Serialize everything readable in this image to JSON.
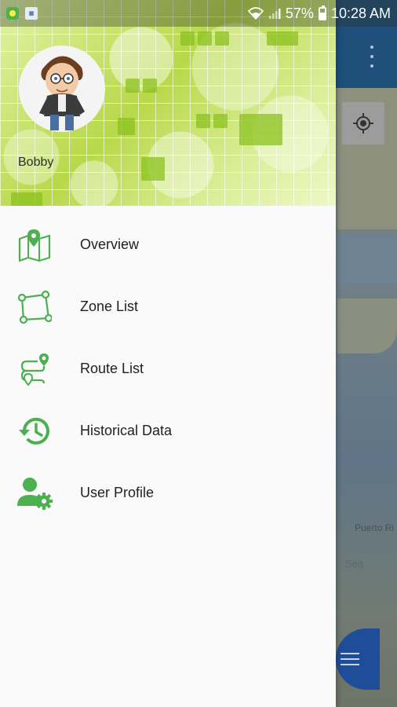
{
  "status_bar": {
    "battery": "57%",
    "time": "10:28 AM"
  },
  "drawer": {
    "user": {
      "name": "Bobby"
    },
    "menu": [
      {
        "label": "Overview",
        "icon": "map-pin-icon"
      },
      {
        "label": "Zone List",
        "icon": "zone-polygon-icon"
      },
      {
        "label": "Route List",
        "icon": "route-icon"
      },
      {
        "label": "Historical Data",
        "icon": "history-icon"
      },
      {
        "label": "User Profile",
        "icon": "user-settings-icon"
      }
    ]
  },
  "map": {
    "labels": [
      "Puerto Ri",
      "Sea"
    ]
  },
  "colors": {
    "icon_green": "#4caf50",
    "header_green": "#b8d84a",
    "toolbar": "#1f4f7a",
    "fab": "#1e4e9a"
  }
}
